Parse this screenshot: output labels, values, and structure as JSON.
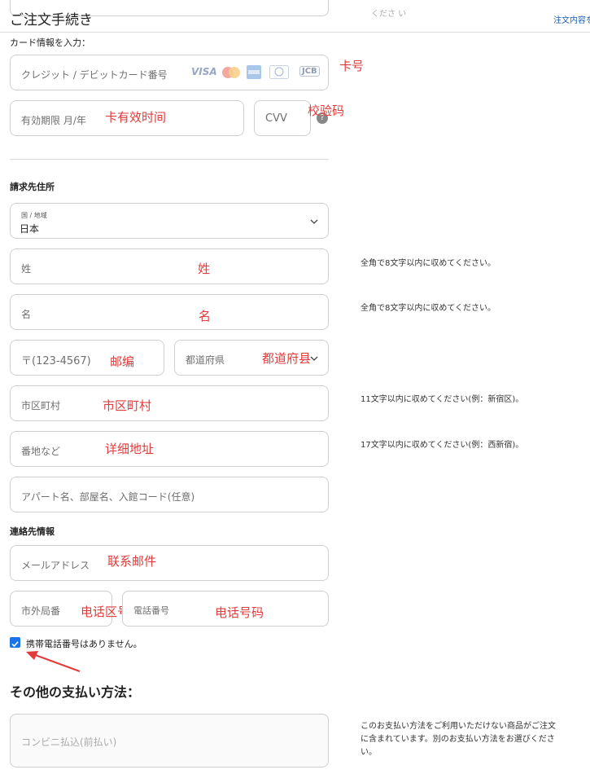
{
  "header": {
    "title": "ご注文手続き",
    "order_link": "注文内容を",
    "faded_text": "くださ い"
  },
  "card": {
    "section_label": "カード情報を入力：",
    "number_placeholder": "クレジット / デビットカード番号",
    "expiry_placeholder": "有効期限 月/年",
    "cvv_placeholder": "CVV",
    "help_glyph": "?",
    "brand_visa": "VISA",
    "brand_jcb": "JCB",
    "annot_number": "卡号",
    "annot_expiry": "卡有效时间",
    "annot_cvv": "校验码"
  },
  "billing": {
    "section_label": "請求先住所",
    "country_label": "国 / 地域",
    "country_value": "日本",
    "last_name_placeholder": "姓",
    "first_name_placeholder": "名",
    "postal_placeholder": "〒(123-4567)",
    "prefecture_placeholder": "都道府県",
    "city_placeholder": "市区町村",
    "street_placeholder": "番地など",
    "building_placeholder": "アパート名、部屋名、入館コード(任意)",
    "annot_last_name": "姓",
    "annot_first_name": "名",
    "annot_postal": "邮编",
    "annot_prefecture": "都道府县",
    "annot_city": "市区町村",
    "annot_street": "详细地址",
    "note_last_name": "全角で8文字以内に収めてください。",
    "note_first_name": "全角で8文字以内に収めてください。",
    "note_city": "11文字以内に収めてください(例：新宿区)。",
    "note_street": "17文字以内に収めてください(例：西新宿)。"
  },
  "contact": {
    "section_label": "連絡先情報",
    "email_placeholder": "メールアドレス",
    "area_code_placeholder": "市外局番",
    "phone_placeholder": "電話番号",
    "no_mobile_label": "携帯電話番号はありません。",
    "no_mobile_checked": true,
    "annot_email": "联系邮件",
    "annot_area_code": "电话区号",
    "annot_phone": "电话号码"
  },
  "other_payment": {
    "heading": "その他の支払い方法：",
    "konbini_label": "コンビニ払込(前払い)",
    "note_lines": [
      "このお支払い方法をご利用いただけない商品がご注文",
      "に含まれています。別のお支払い方法をお選びくださ",
      "い。"
    ]
  },
  "colors": {
    "annotation": "#e23b3b",
    "checkbox": "#1a73e8",
    "link": "#1a5fb4"
  }
}
